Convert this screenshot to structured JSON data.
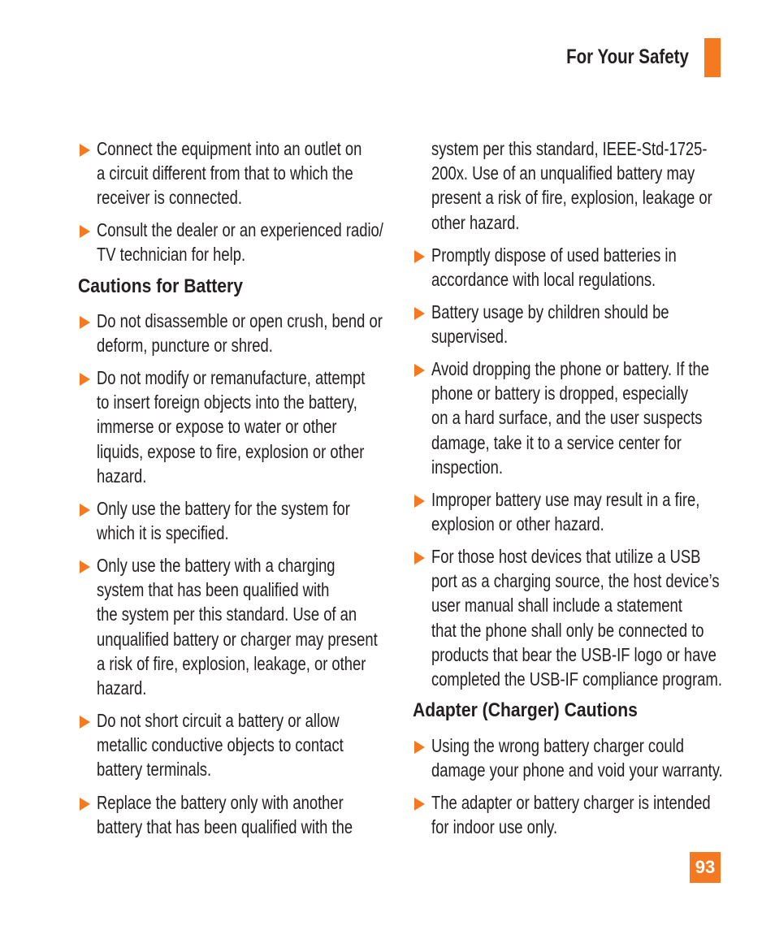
{
  "header": {
    "title": "For Your Safety",
    "accent_color": "#f47920"
  },
  "left_column": {
    "items_top": [
      {
        "lines": [
          "Connect the equipment into an outlet on",
          "a circuit different from that to which the",
          "receiver is connected."
        ]
      },
      {
        "lines": [
          "Consult the dealer or an experienced radio/",
          "TV technician for help."
        ]
      }
    ],
    "heading": "Cautions for Battery",
    "items": [
      {
        "lines": [
          "Do not disassemble or open crush, bend or",
          "deform, puncture or shred."
        ]
      },
      {
        "lines": [
          "Do not modify or remanufacture, attempt",
          "to insert foreign objects into the battery,",
          "immerse or expose to water or other",
          "liquids, expose to fire, explosion or other",
          "hazard."
        ]
      },
      {
        "lines": [
          "Only use the battery for the system for",
          "which it is specified."
        ]
      },
      {
        "lines": [
          "Only use the battery with a charging",
          "system that has been qualified with",
          "the system per this standard. Use of an",
          "unqualified battery or charger may present",
          "a risk of fire, explosion, leakage, or other",
          "hazard."
        ]
      },
      {
        "lines": [
          "Do not short circuit a battery or allow",
          "metallic conductive objects to contact",
          "battery terminals."
        ]
      },
      {
        "lines": [
          "Replace the battery only with another",
          "battery that has been qualified with the"
        ]
      }
    ]
  },
  "right_column": {
    "continuation": {
      "lines": [
        "system per this standard, IEEE-Std-1725-",
        "200x. Use of an unqualified battery may",
        "present a risk of fire, explosion, leakage or",
        "other hazard."
      ]
    },
    "items": [
      {
        "lines": [
          "Promptly dispose of used batteries in",
          "accordance with local regulations."
        ]
      },
      {
        "lines": [
          "Battery usage by children should be",
          "supervised."
        ]
      },
      {
        "lines": [
          "Avoid dropping the phone or battery. If the",
          "phone or battery is dropped, especially",
          "on a hard surface, and the user suspects",
          "damage, take it to a service center for",
          "inspection."
        ]
      },
      {
        "lines": [
          "Improper battery use may result in a fire,",
          "explosion or other hazard."
        ]
      },
      {
        "lines": [
          "For those host devices that utilize a USB",
          "port as a charging source, the host device’s",
          "user manual shall include a statement",
          "that the phone shall only be connected to",
          "products that bear the USB-IF logo or have",
          "completed the USB-IF compliance program."
        ]
      }
    ],
    "heading": "Adapter (Charger) Cautions",
    "items2": [
      {
        "lines": [
          "Using the wrong battery charger could",
          "damage your phone and void your warranty."
        ]
      },
      {
        "lines": [
          "The adapter or battery charger is intended",
          "for indoor use only."
        ]
      }
    ]
  },
  "footer": {
    "page_number": "93"
  }
}
